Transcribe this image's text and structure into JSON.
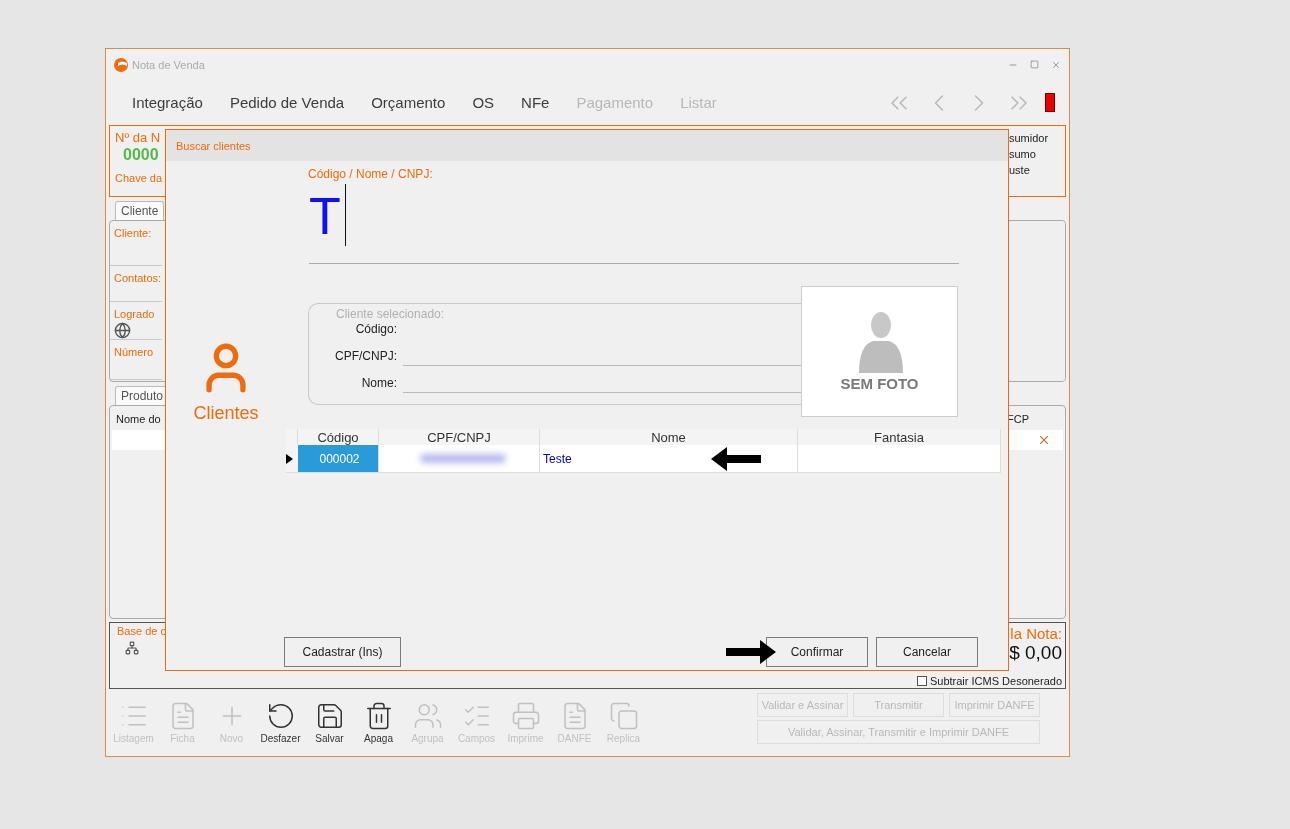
{
  "window": {
    "title": "Nota de Venda"
  },
  "menu": [
    {
      "label": "Integração",
      "disabled": false
    },
    {
      "label": "Pedido de Venda",
      "disabled": false
    },
    {
      "label": "Orçamento",
      "disabled": false
    },
    {
      "label": "OS",
      "disabled": false
    },
    {
      "label": "NFe",
      "disabled": false
    },
    {
      "label": "Pagamento",
      "disabled": true
    },
    {
      "label": "Listar",
      "disabled": true
    }
  ],
  "header": {
    "number_label": "Nº da N",
    "number_value": "0000",
    "key_label": "Chave da",
    "right_texts": [
      "sumidor",
      "sumo",
      "uste"
    ]
  },
  "client_panel": {
    "tab": "Cliente",
    "fields": [
      "Cliente:",
      "Contatos:",
      "Logrado",
      "Número"
    ]
  },
  "products_panel": {
    "tab": "Produto",
    "first_column": "Nome do",
    "last_column": "FCP"
  },
  "totals": {
    "base_label": "Base de c",
    "total_label": "la Nota:",
    "total_value": "$ 0,00",
    "subtract_icms": {
      "label": "Subtrair ICMS Desonerado",
      "checked": false
    }
  },
  "toolbar": [
    {
      "label": "Listagem",
      "disabled": true
    },
    {
      "label": "Ficha",
      "disabled": true
    },
    {
      "label": "Novo",
      "disabled": true
    },
    {
      "label": "Desfazer",
      "disabled": false
    },
    {
      "label": "Salvar",
      "disabled": false
    },
    {
      "label": "Apaga",
      "disabled": false
    },
    {
      "label": "Agrupa",
      "disabled": true
    },
    {
      "label": "Campos",
      "disabled": true
    },
    {
      "label": "Imprime",
      "disabled": true
    },
    {
      "label": "DANFE",
      "disabled": true
    },
    {
      "label": "Replica",
      "disabled": true
    }
  ],
  "actions": [
    {
      "label": "Validar e Assinar",
      "disabled": true
    },
    {
      "label": "Transmitir",
      "disabled": true
    },
    {
      "label": "Imprimir DANFE",
      "disabled": true
    },
    {
      "label": "Validar, Assinar, Transmitir e Imprimir DANFE",
      "disabled": true
    }
  ],
  "dialog": {
    "title": "Buscar clientes",
    "side_label": "Clientes",
    "search": {
      "label": "Código / Nome / CNPJ:",
      "value": "T"
    },
    "selected_client": {
      "legend": "Cliente selecionado:",
      "fields": [
        "Código:",
        "CPF/CNPJ:",
        "Nome:"
      ]
    },
    "photo": {
      "caption": "SEM FOTO"
    },
    "grid": {
      "columns": [
        "Código",
        "CPF/CNPJ",
        "Nome",
        "Fantasia"
      ],
      "rows": [
        {
          "selected": true,
          "code": "000002",
          "name": "Teste"
        }
      ]
    },
    "buttons": [
      "Cadastrar (Ins)",
      "Confirmar",
      "Cancelar"
    ]
  }
}
